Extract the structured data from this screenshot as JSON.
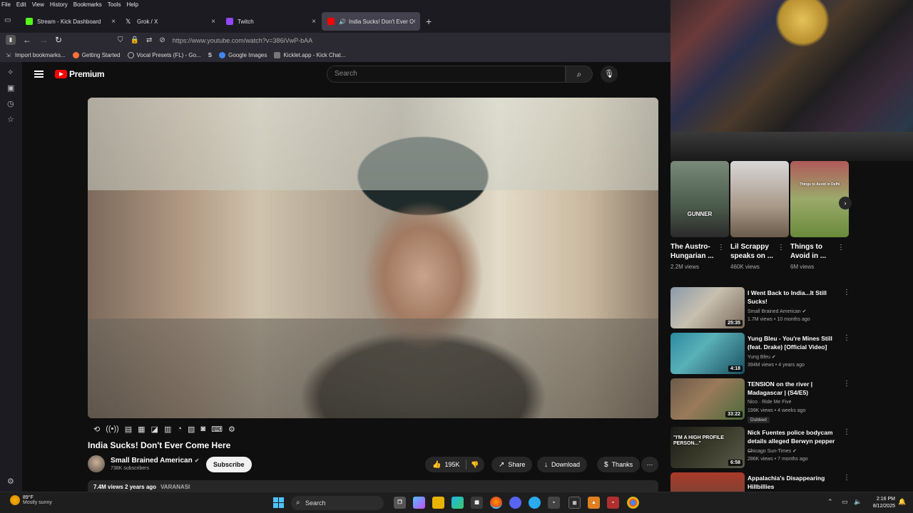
{
  "menu": [
    "File",
    "Edit",
    "View",
    "History",
    "Bookmarks",
    "Tools",
    "Help"
  ],
  "tabs": [
    {
      "label": "Stream - Kick Dashboard",
      "color": "#53fc18"
    },
    {
      "label": "Grok / X",
      "color": "#ffffff"
    },
    {
      "label": "Twitch",
      "color": "#9146ff"
    },
    {
      "label": "India Sucks! Don't Ever Com",
      "color": "#ff0000"
    }
  ],
  "url": "https://www.youtube.com/watch?v=386iVwP-bAA",
  "bookmarks": [
    {
      "label": "Import bookmarks...",
      "color": "#888888"
    },
    {
      "label": "Getting Started",
      "color": "#ff7139"
    },
    {
      "label": "Vocal Presets (FL) - Go...",
      "color": "#bbbbbb"
    },
    {
      "label": "S",
      "color": "#333333"
    },
    {
      "label": "Google Images",
      "color": "#4285f4"
    },
    {
      "label": "Kicklet.app - Kick Chat...",
      "color": "#777777"
    }
  ],
  "youtube": {
    "logo": "Premium",
    "search_placeholder": "Search",
    "video_title": "India Sucks! Don't Ever Come Here",
    "channel_name": "Small Brained American",
    "subscribers": "738K subscribers",
    "subscribe_label": "Subscribe",
    "likes": "195K",
    "share_label": "Share",
    "download_label": "Download",
    "thanks_label": "Thanks",
    "views_date": "7.4M views  2 years ago",
    "location": "VARANASI"
  },
  "shorts": [
    {
      "title": "The Austro-Hungarian ...",
      "views": "2.2M views",
      "overlay": "GUNNER"
    },
    {
      "title": "Lil Scrappy speaks on ...",
      "views": "460K views",
      "overlay": ""
    },
    {
      "title": "Things to Avoid in ...",
      "views": "6M views",
      "overlay": "Things to Avoid in Delhi"
    }
  ],
  "recommended": [
    {
      "title": "I Went Back to India...It Still Sucks!",
      "channel": "Small Brained American",
      "verified": true,
      "meta": "1.7M views • 10 months ago",
      "duration": "25:35",
      "badge": "",
      "overlay": ""
    },
    {
      "title": "Yung Bleu - You're Mines Still (feat. Drake) [Official Video]",
      "channel": "Yung Bleu",
      "verified": true,
      "meta": "394M views • 4 years ago",
      "duration": "4:18",
      "badge": "",
      "overlay": ""
    },
    {
      "title": "TENSION on the river | Madagascar | (S4/E5)",
      "channel": "Nico · Ride Me Five",
      "verified": false,
      "meta": "199K views • 4 weeks ago",
      "duration": "33:22",
      "badge": "Dubbed",
      "overlay": ""
    },
    {
      "title": "Nick Fuentes police bodycam details alleged Berwyn pepper ...",
      "channel": "Chicago Sun-Times",
      "verified": true,
      "meta": "286K views • 7 months ago",
      "duration": "6:58",
      "badge": "",
      "overlay": "\"I'M A HIGH PROFILE PERSON...\""
    },
    {
      "title": "Appalachia's Disappearing Hillbillies",
      "channel": "",
      "verified": false,
      "meta": "",
      "duration": "",
      "badge": "",
      "overlay": ""
    }
  ],
  "taskbar": {
    "temp": "89°F",
    "condition": "Mostly sunny",
    "search": "Search",
    "time": "2:16 PM",
    "date": "8/12/2025"
  }
}
